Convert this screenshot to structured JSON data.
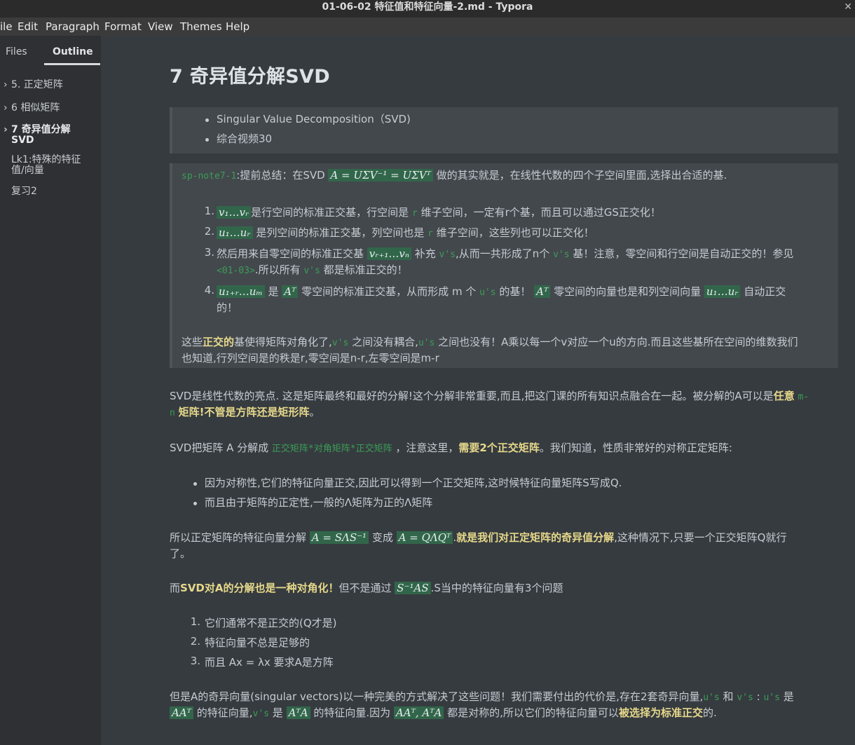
{
  "window": {
    "title": "01-06-02 特征值和特征向量-2.md - Typora",
    "close": "✕"
  },
  "menu": [
    "ile",
    "Edit",
    "Paragraph",
    "Format",
    "View",
    "Themes",
    "Help"
  ],
  "sidebar": {
    "tabs": [
      "Files",
      "Outline"
    ],
    "outline": [
      {
        "label": "5. 正定矩阵",
        "arrow": "›"
      },
      {
        "label": "6 相似矩阵",
        "arrow": "›"
      },
      {
        "label": "7 奇异值分解 SVD",
        "line1": "7 奇异值分解",
        "line2": "SVD",
        "arrow": "›"
      },
      {
        "label": "Lk1:特殊的特征值/向量",
        "line1": "Lk1:特殊的特征",
        "line2": "值/向量"
      },
      {
        "label": "复习2"
      }
    ]
  },
  "doc": {
    "h1": "7 奇异值分解SVD",
    "box1": [
      "Singular Value Decomposition（SVD)",
      "综合视频30"
    ],
    "note": {
      "tag": "sp-note7-1",
      "intro_a": ":提前总结：在SVD",
      "intro_math": "A = UΣV⁻¹ = UΣVᵀ",
      "intro_b": "做的其实就是，在线性代数的四个子空间里面,选择出合适的基.",
      "items": [
        {
          "n": "1.",
          "m1": "v₁…vᵣ",
          "t1": "是行空间的标准正交基，行空间是",
          "c1": "r",
          "t2": "维子空间，一定有r个基，而且可以通过GS正交化！"
        },
        {
          "n": "2.",
          "m1": "u₁…uᵣ",
          "t1": "是列空间的标准正交基，列空间也是",
          "c1": "r",
          "t2": "维子空间，这些列也可以正交化！"
        },
        {
          "n": "3.",
          "t0": "然后用来自零空间的标准正交基",
          "m1": "vᵣ₊₁…vₙ",
          "t1": "补充",
          "c1": "v's",
          "t2": ",从而一共形成了n个",
          "c2": "v's",
          "t3": "基！注意，零空间和行空间是自动正交的！参见",
          "c3": "<01-03>",
          "t4": ".所以所有",
          "c4": "v's",
          "t5": "都是标准正交的！"
        },
        {
          "n": "4.",
          "m1": "u₁₊ᵣ…uₘ",
          "t1": "是",
          "m2": "Aᵀ",
          "t2": "零空间的标准正交基，从而形成 m 个",
          "c1": "u's",
          "t3": "的基！",
          "m3": "Aᵀ",
          "t4": "零空间的向量也是和列空间向量",
          "m4": "u₁…uᵣ",
          "t5": "自动正交",
          "t6": "的！"
        }
      ],
      "outro_a": "这些",
      "outro_b": "正交的",
      "outro_c": "基使得矩阵对角化了,",
      "outro_c1": "v's",
      "outro_d": "之间没有耦合,",
      "outro_c2": "u's",
      "outro_e": "之间也没有！A乘以每一个v对应一个u的方向.而且这些基所在空间的维数我们",
      "outro_f": "也知道,行列空间是的秩是r,零空间是n-r,左零空间是m-r"
    },
    "p1": {
      "a": "SVD是线性代数的亮点. 这是矩阵最终和最好的分解!这个分解非常重要,而且,把这门课的所有知识点融合在一起。被分解的A可以是",
      "b": "任意",
      "c": "m-",
      "d": "n",
      "e": "矩阵!不管是方阵还是矩形阵",
      "f": "。"
    },
    "p2": {
      "a": "SVD把矩阵 A 分解成",
      "code": "正交矩阵*对角矩阵*正交矩阵",
      "b": "，注意这里，",
      "bold": "需要2个正交矩阵",
      "c": "。我们知道，性质非常好的对称正定矩阵:"
    },
    "bullets": [
      "因为对称性,它们的特征向量正交,因此可以得到一个正交矩阵,这时候特征向量矩阵S写成Q.",
      "而且由于矩阵的正定性,一般的Λ矩阵为正的Λ矩阵"
    ],
    "p3": {
      "a": "所以正定矩阵的特征向量分解",
      "m1": "A = SΛS⁻¹",
      "b": "变成",
      "m2": "A = QΛQᵀ",
      "c": ".",
      "bold": "就是我们对正定矩阵的奇异值分解",
      "d": ",这种情况下,只要一个正交矩阵Q就行",
      "e": "了。"
    },
    "p4": {
      "a": "而",
      "bold": "SVD对A的分解也是一种对角化！",
      "b": "但不是通过",
      "m1": "S⁻¹AS",
      "c": ".S当中的特征向量有3个问题"
    },
    "olist": [
      "它们通常不是正交的(Q才是)",
      "特征向量不总是足够的",
      "而且 Ax = λx 要求A是方阵"
    ],
    "olist_nums": [
      "1.",
      "2.",
      "3."
    ],
    "p5": {
      "a": "但是A的奇异向量(singular vectors)以一种完美的方式解决了这些问题！我们需要付出的代价是,存在2套奇异向量,",
      "c1": "u's",
      "b": "和",
      "c2": "v's",
      "c": ":",
      "c3": "u's",
      "d": "是",
      "m1": "AAᵀ",
      "e": "的特征向量,",
      "c4": "v's",
      "f": "是",
      "m2": "AᵀA",
      "g": "的特征向量.因为",
      "m3": "AAᵀ, AᵀA",
      "h": "都是对称的,所以它们的特征向量可以",
      "bold": "被选择为标准正交",
      "i": "的."
    }
  }
}
